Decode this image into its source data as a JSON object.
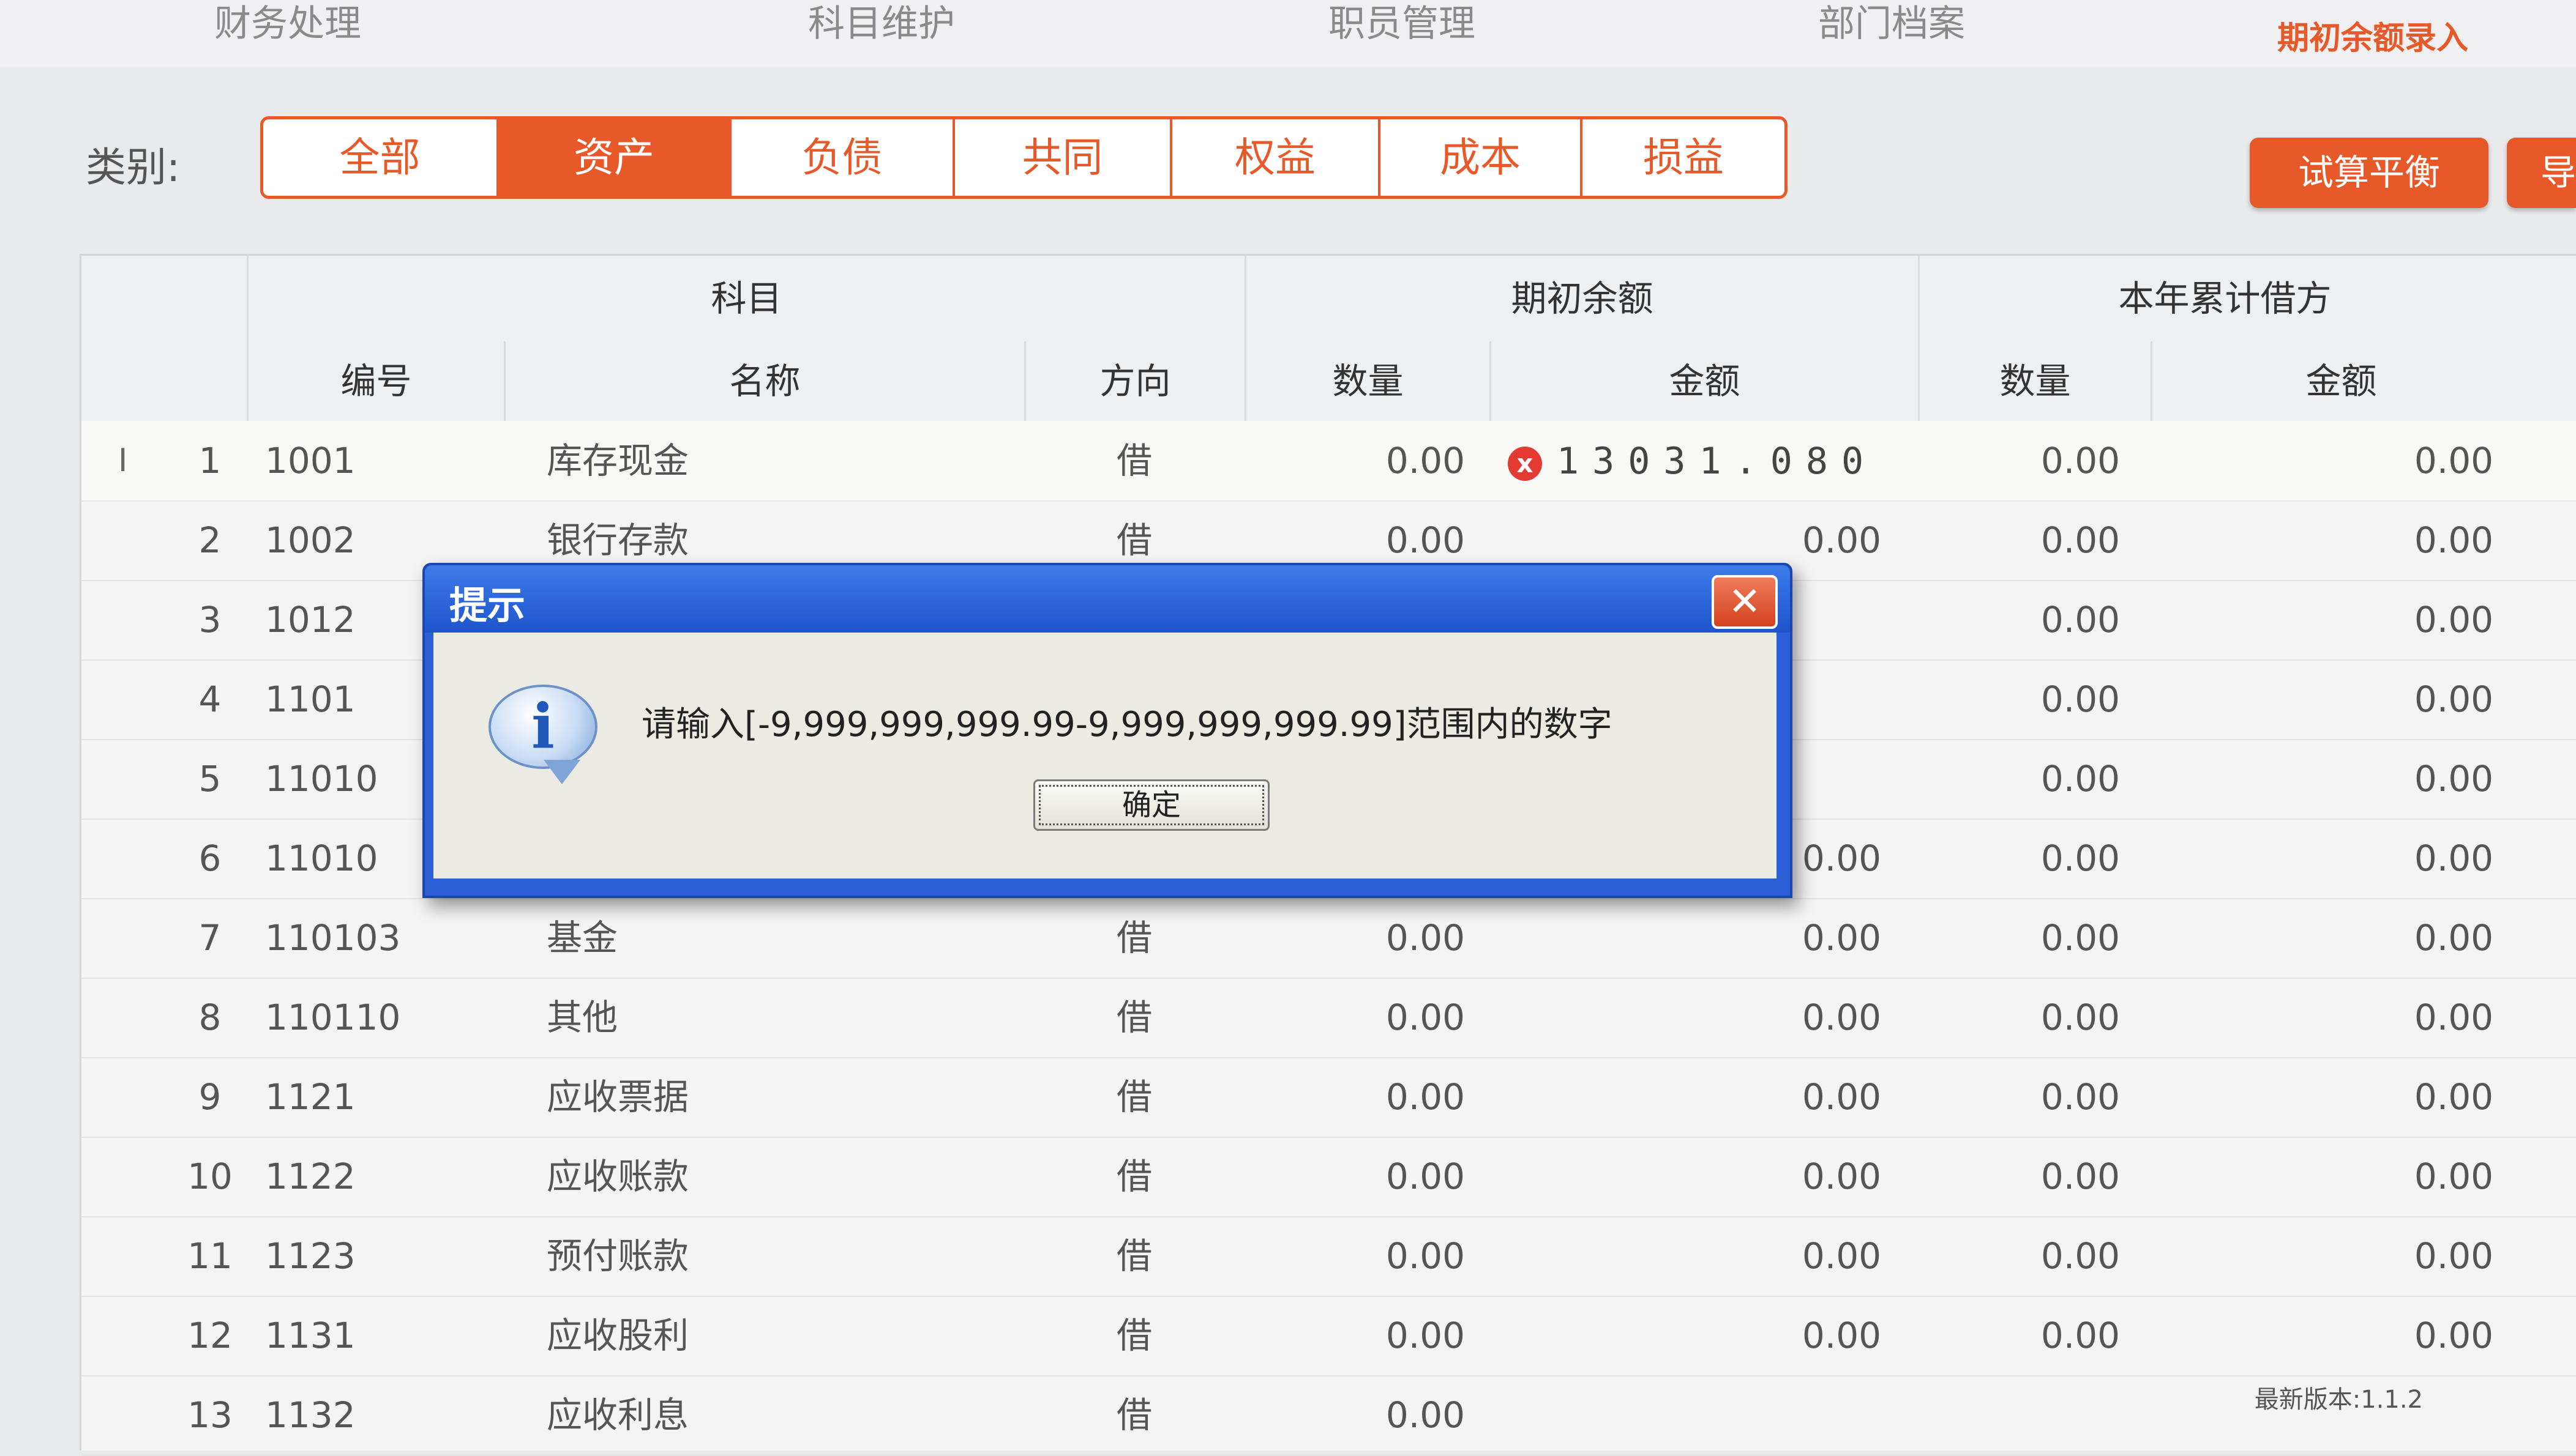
{
  "topnav": {
    "items": [
      "财务处理",
      "科目维护",
      "职员管理",
      "部门档案",
      "期初余额录入"
    ]
  },
  "filter": {
    "label": "类别:",
    "segments": [
      "全部",
      "资产",
      "负债",
      "共同",
      "权益",
      "成本",
      "损益"
    ],
    "active": "资产"
  },
  "actions": {
    "trial_balance": "试算平衡",
    "more": "导"
  },
  "table": {
    "group_headers": [
      "科目",
      "期初余额",
      "本年累计借方"
    ],
    "sub_headers": [
      "编号",
      "名称",
      "方向",
      "数量",
      "金额",
      "数量",
      "金额"
    ],
    "cursor_marker": "I",
    "editing_value": "13031.080",
    "error_badge": "x",
    "rows": [
      {
        "idx": "1",
        "code": "1001",
        "name": "库存现金",
        "dir": "借",
        "qty": "0.00",
        "amount": "",
        "ytd_qty": "0.00",
        "ytd_amt": "0.00"
      },
      {
        "idx": "2",
        "code": "1002",
        "name": "银行存款",
        "dir": "借",
        "qty": "0.00",
        "amount": "0.00",
        "ytd_qty": "0.00",
        "ytd_amt": "0.00"
      },
      {
        "idx": "3",
        "code": "1012",
        "name": "",
        "dir": "",
        "qty": "",
        "amount": "",
        "ytd_qty": "0.00",
        "ytd_amt": "0.00"
      },
      {
        "idx": "4",
        "code": "1101",
        "name": "",
        "dir": "",
        "qty": "",
        "amount": "",
        "ytd_qty": "0.00",
        "ytd_amt": "0.00"
      },
      {
        "idx": "5",
        "code": "11010",
        "name": "",
        "dir": "",
        "qty": "",
        "amount": "",
        "ytd_qty": "0.00",
        "ytd_amt": "0.00"
      },
      {
        "idx": "6",
        "code": "11010",
        "name": "",
        "dir": "",
        "qty": "",
        "amount": "0.00",
        "ytd_qty": "0.00",
        "ytd_amt": "0.00"
      },
      {
        "idx": "7",
        "code": "110103",
        "name": "基金",
        "dir": "借",
        "qty": "0.00",
        "amount": "0.00",
        "ytd_qty": "0.00",
        "ytd_amt": "0.00"
      },
      {
        "idx": "8",
        "code": "110110",
        "name": "其他",
        "dir": "借",
        "qty": "0.00",
        "amount": "0.00",
        "ytd_qty": "0.00",
        "ytd_amt": "0.00"
      },
      {
        "idx": "9",
        "code": "1121",
        "name": "应收票据",
        "dir": "借",
        "qty": "0.00",
        "amount": "0.00",
        "ytd_qty": "0.00",
        "ytd_amt": "0.00"
      },
      {
        "idx": "10",
        "code": "1122",
        "name": "应收账款",
        "dir": "借",
        "qty": "0.00",
        "amount": "0.00",
        "ytd_qty": "0.00",
        "ytd_amt": "0.00"
      },
      {
        "idx": "11",
        "code": "1123",
        "name": "预付账款",
        "dir": "借",
        "qty": "0.00",
        "amount": "0.00",
        "ytd_qty": "0.00",
        "ytd_amt": "0.00"
      },
      {
        "idx": "12",
        "code": "1131",
        "name": "应收股利",
        "dir": "借",
        "qty": "0.00",
        "amount": "0.00",
        "ytd_qty": "0.00",
        "ytd_amt": "0.00"
      },
      {
        "idx": "13",
        "code": "1132",
        "name": "应收利息",
        "dir": "借",
        "qty": "0.00",
        "amount": "",
        "ytd_qty": "",
        "ytd_amt": ""
      }
    ]
  },
  "dialog": {
    "title": "提示",
    "close_icon": "close-icon",
    "info_icon": "i",
    "message": "请输入[-9,999,999,999.99-9,999,999,999.99]范围内的数字",
    "ok_label": "确定"
  },
  "status": {
    "version": "最新版本:1.1.2"
  },
  "colors": {
    "accent": "#e8592a",
    "dialog_blue": "#2c5fd6",
    "error": "#e43a34"
  }
}
